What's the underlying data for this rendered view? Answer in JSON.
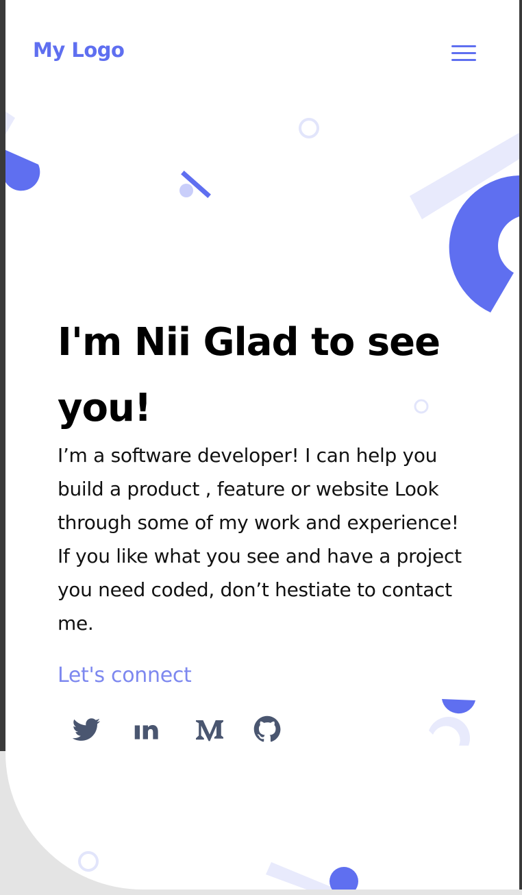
{
  "header": {
    "logo_text": "My Logo",
    "menu_icon": "hamburger-menu-icon"
  },
  "hero": {
    "title": "I'm Nii Glad to see you!",
    "description": "I’m a software developer! I can help you build a product , feature or website Look through some of my work and experience! If you like what you see and have a project you need coded, don’t hestiate to contact me.",
    "connect_label": "Let's connect"
  },
  "social_links": [
    {
      "name": "twitter",
      "icon": "twitter-icon"
    },
    {
      "name": "linkedin",
      "icon": "linkedin-icon"
    },
    {
      "name": "medium",
      "icon": "medium-icon",
      "glyph": "M"
    },
    {
      "name": "github",
      "icon": "github-icon"
    }
  ],
  "colors": {
    "accent": "#5f6ff0",
    "accent_light": "#e8eafc",
    "link": "#7d88ef",
    "social_icon": "#4a5670",
    "text": "#000000"
  }
}
